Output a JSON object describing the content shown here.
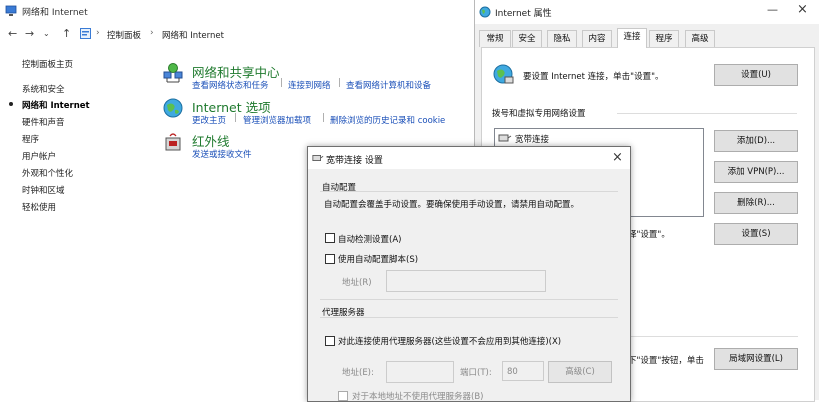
{
  "control_panel": {
    "title": "网络和 Internet",
    "breadcrumb": [
      "控制面板",
      "网络和 Internet"
    ],
    "left_nav": [
      {
        "label": "控制面板主页"
      },
      {
        "label": "系统和安全"
      },
      {
        "label": "网络和 Internet",
        "active": true
      },
      {
        "label": "硬件和声音"
      },
      {
        "label": "程序"
      },
      {
        "label": "用户帐户"
      },
      {
        "label": "外观和个性化"
      },
      {
        "label": "时钟和区域"
      },
      {
        "label": "轻松使用"
      }
    ],
    "categories": [
      {
        "title": "网络和共享中心",
        "links": [
          "查看网络状态和任务",
          "连接到网络",
          "查看网络计算机和设备"
        ]
      },
      {
        "title": "Internet 选项",
        "links": [
          "更改主页",
          "管理浏览器加载项",
          "删除浏览的历史记录和 cookie"
        ]
      },
      {
        "title": "红外线",
        "links": [
          "发送或接收文件"
        ]
      }
    ]
  },
  "internet_properties": {
    "title": "Internet 属性",
    "tabs": [
      "常规",
      "安全",
      "隐私",
      "内容",
      "连接",
      "程序",
      "高级"
    ],
    "selected_tab": "连接",
    "setup_text": "要设置 Internet 连接，单击\"设置\"。",
    "setup_button": "设置(U)",
    "dialup_section": "拨号和虚拟专用网络设置",
    "connection_item": "宽带连接",
    "add_button": "添加(D)...",
    "add_vpn_button": "添加 VPN(P)...",
    "remove_button": "删除(R)...",
    "settings_hint": "择\"设置\"。",
    "settings_button": "设置(S)",
    "lan_hint": "下\"设置\"按钮，单击",
    "lan_button": "局域网设置(L)"
  },
  "dialog": {
    "title": "宽带连接 设置",
    "auto_config_group": "自动配置",
    "auto_config_desc": "自动配置会覆盖手动设置。要确保使用手动设置，请禁用自动配置。",
    "auto_detect": "自动检测设置(A)",
    "auto_script": "使用自动配置脚本(S)",
    "address_label": "地址(R)",
    "proxy_group": "代理服务器",
    "use_proxy": "对此连接使用代理服务器(这些设置不会应用到其他连接)(X)",
    "proxy_address_label": "地址(E):",
    "port_label": "端口(T):",
    "port_value": "80",
    "advanced_button": "高级(C)",
    "bypass_local": "对于本地地址不使用代理服务器(B)"
  },
  "colors": {
    "accent_green": "#1f7a2e",
    "link_blue": "#1a4fb8"
  }
}
